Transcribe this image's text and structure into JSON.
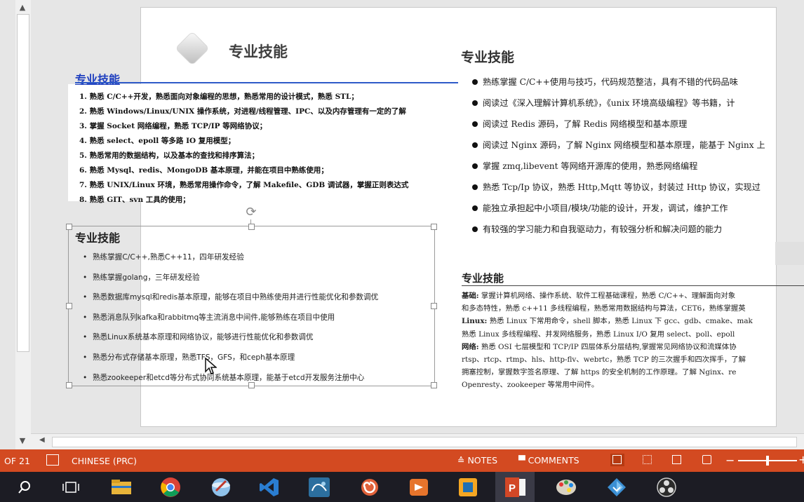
{
  "slide": {
    "title_main": "专业技能",
    "title_right": "专业技能",
    "resume1": {
      "title": "专业技能",
      "items": [
        "1. 熟悉 C/C++开发，熟悉面向对象编程的思想，熟悉常用的设计模式，熟悉 STL；",
        "2. 熟悉 Windows/Linux/UNIX 操作系统，对进程/线程管理、IPC、以及内存管理有一定的了解",
        "3. 掌握 Socket 网络编程，熟悉 TCP/IP 等网络协议；",
        "4. 熟悉 select、epoll 等多路 IO 复用模型；",
        "5. 熟悉常用的数据结构，以及基本的查找和排序算法；",
        "6. 熟悉 Mysql、redis、MongoDB 基本原理，并能在项目中熟练使用；",
        "7. 熟悉 UNIX/Linux 环境，熟悉常用操作命令，了解 Makefile、GDB 调试器，掌握正则表达式",
        "8. 熟悉 GIT、svn 工具的使用；"
      ]
    },
    "textbox": {
      "title": "专业技能",
      "items": [
        "熟练掌握C/C++,熟悉C++11，四年研发经验",
        "熟练掌握golang，三年研发经验",
        "熟悉数据库mysql和redis基本原理，能够在项目中熟练使用并进行性能优化和参数调优",
        "熟悉消息队列kafka和rabbitmq等主流消息中间件,能够熟练在项目中使用",
        "熟悉Linux系统基本原理和网络协议，能够进行性能优化和参数调优",
        "熟悉分布式存储基本原理，熟悉TFS，GFS，和ceph基本原理",
        "熟悉zookeeper和etcd等分布式协同系统基本原理，能基于etcd开发服务注册中心"
      ]
    },
    "resume2": {
      "items": [
        "熟练掌握 C/C++使用与技巧，代码规范整洁，具有不错的代码品味",
        "阅读过《深入理解计算机系统》，《unix 环境高级编程》等书籍，计",
        "阅读过 Redis 源码，了解 Redis 网络模型和基本原理",
        "阅读过 Nginx 源码，了解 Nginx 网络模型和基本原理，能基于 Nginx 上",
        "掌握 zmq,libevent 等网络开源库的使用，熟悉网络编程",
        "熟悉 Tcp/Ip 协议，熟悉 Http,Mqtt 等协议，封装过 Http 协议，实现过",
        "能独立承担起中小项目/模块/功能的设计，开发，调试，维护工作",
        "有较强的学习能力和自我驱动力，有较强分析和解决问题的能力"
      ]
    },
    "resume3": {
      "title": "专业技能",
      "lines": [
        {
          "label": "基础:",
          "text": " 掌握计算机网络、操作系统、软件工程基础课程，熟悉 C/C++、理解面向对象"
        },
        {
          "label": "",
          "text": "和多态特性，熟悉 c++11 多线程编程，熟悉常用数据结构与算法，CET6，熟练掌握英"
        },
        {
          "label": "Linux:",
          "text": " 熟悉 Linux 下常用命令，shell 脚本，熟悉 Linux 下 gcc、gdb、cmake、mak"
        },
        {
          "label": "",
          "text": "熟悉 Linux 多线程编程、并发网络服务，熟悉 Linux I/O 复用 select、poll、epoll"
        },
        {
          "label": "网络:",
          "text": " 熟悉 OSI 七层模型和 TCP/IP 四层体系分层结构,掌握常见网络协议和流媒体协"
        },
        {
          "label": "",
          "text": "rtsp、rtcp、rtmp、hls、http-flv、webrtc，熟悉 TCP 的三次握手和四次挥手，了解"
        },
        {
          "label": "",
          "text": "拥塞控制，掌握数字签名原理、了解 https 的安全机制的工作原理。了解 Nginx、re"
        },
        {
          "label": "",
          "text": "Openresty、zookeeper 等常用中间件。"
        }
      ]
    }
  },
  "statusbar": {
    "page": "OF 21",
    "language": "CHINESE (PRC)",
    "notes": "NOTES",
    "comments": "COMMENTS"
  },
  "taskbar": {
    "apps": [
      "search",
      "task-view",
      "file-explorer",
      "chrome",
      "app-blue",
      "visual-studio",
      "mysql-workbench",
      "app-spiral",
      "app-orange",
      "app-box",
      "powerpoint",
      "paint",
      "app-diamond",
      "obs"
    ]
  },
  "colors": {
    "statusbar": "#d34a21",
    "taskbar": "#1c1c24",
    "link_blue": "#1f3fbf"
  }
}
